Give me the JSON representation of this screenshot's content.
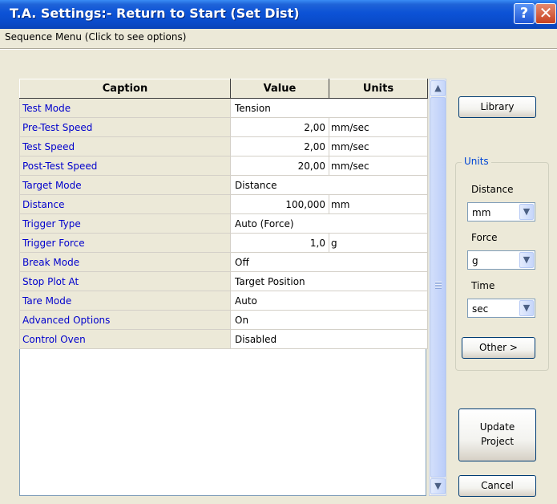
{
  "window": {
    "title": "T.A. Settings:- Return to Start (Set Dist)",
    "help_label": "?",
    "close_label": "✕"
  },
  "menu": {
    "sequence_label": "Sequence Menu (Click to see options)"
  },
  "grid": {
    "headers": {
      "caption": "Caption",
      "value": "Value",
      "units": "Units"
    },
    "rows": [
      {
        "caption": "Test Mode",
        "value": "Tension",
        "units": ""
      },
      {
        "caption": "Pre-Test Speed",
        "value": "2,00",
        "units": "mm/sec"
      },
      {
        "caption": "Test Speed",
        "value": "2,00",
        "units": "mm/sec"
      },
      {
        "caption": "Post-Test Speed",
        "value": "20,00",
        "units": "mm/sec"
      },
      {
        "caption": "Target Mode",
        "value": "Distance",
        "units": ""
      },
      {
        "caption": "Distance",
        "value": "100,000",
        "units": "mm"
      },
      {
        "caption": "Trigger Type",
        "value": "Auto (Force)",
        "units": ""
      },
      {
        "caption": "Trigger Force",
        "value": "1,0",
        "units": "g"
      },
      {
        "caption": "Break Mode",
        "value": "Off",
        "units": ""
      },
      {
        "caption": "Stop Plot At",
        "value": "Target Position",
        "units": ""
      },
      {
        "caption": "Tare Mode",
        "value": "Auto",
        "units": ""
      },
      {
        "caption": "Advanced Options",
        "value": "On",
        "units": ""
      },
      {
        "caption": "Control Oven",
        "value": "Disabled",
        "units": ""
      }
    ]
  },
  "scrollbar": {
    "up_arrow": "▲",
    "down_arrow": "▼"
  },
  "buttons": {
    "library": "Library",
    "other": "Other  >",
    "update_line1": "Update",
    "update_line2": "Project",
    "cancel": "Cancel"
  },
  "units": {
    "legend": "Units",
    "distance_label": "Distance",
    "distance_value": "mm",
    "force_label": "Force",
    "force_value": "g",
    "time_label": "Time",
    "time_value": "sec",
    "arrow": "▼"
  },
  "colors": {
    "title_bar": "#0C52D6",
    "caption_text": "#0000CC",
    "dialog_bg": "#ECE9D8"
  }
}
